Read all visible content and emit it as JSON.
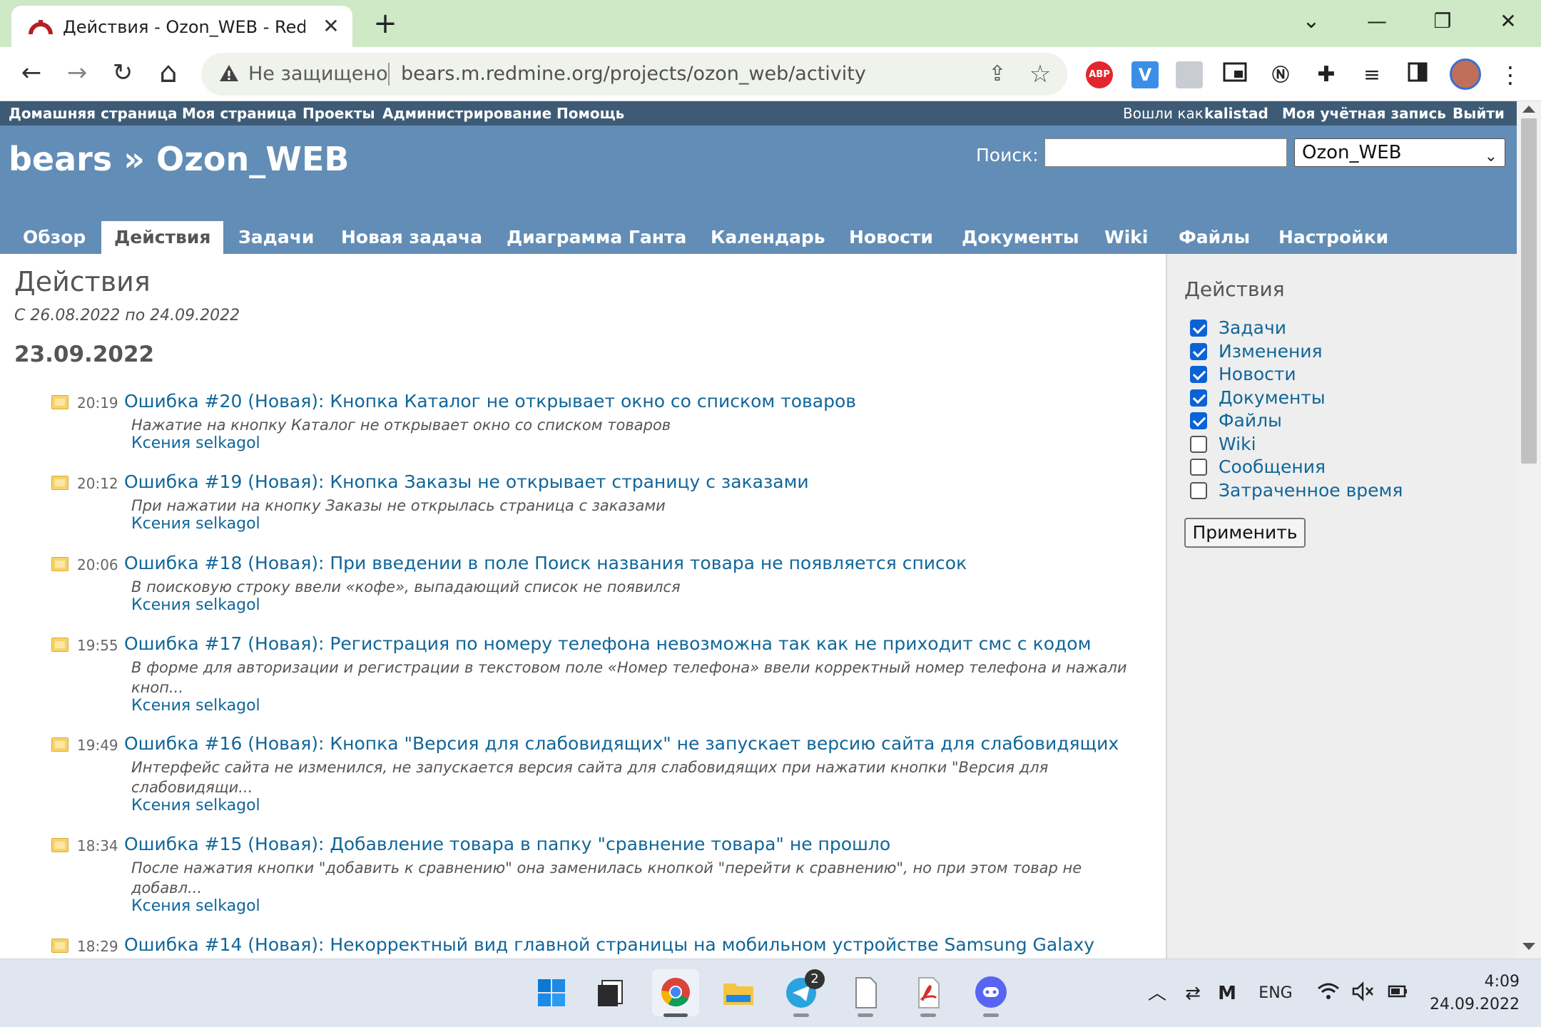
{
  "browser": {
    "tab_title": "Действия - Ozon_WEB - Redmine",
    "tab_close": "✕",
    "new_tab": "+",
    "window_controls": {
      "minimize": "—",
      "restore": "❐",
      "close": "✕",
      "tabs_list": "⌄"
    },
    "nav": {
      "back": "←",
      "forward": "→",
      "reload": "↻",
      "home": "⌂"
    },
    "security_label": "Не защищено",
    "url": "bears.m.redmine.org/projects/ozon_web/activity",
    "extensions": [
      "ABP",
      "V",
      "profile-ext",
      "pip",
      "notion",
      "puzzle",
      "media",
      "sidepanel"
    ],
    "menu": "⋮"
  },
  "top_menu": {
    "left": [
      "Домашняя страница",
      "Моя страница",
      "Проекты",
      "Администрирование",
      "Помощь"
    ],
    "logged_as_prefix": "Вошли как",
    "logged_user": "kalistad",
    "my_account": "Моя учётная запись",
    "logout": "Выйти"
  },
  "header": {
    "title": "bears » Ozon_WEB",
    "search_label": "Поиск:",
    "search_value": "",
    "project_select": "Ozon_WEB"
  },
  "main_menu": {
    "tabs": [
      "Обзор",
      "Действия",
      "Задачи",
      "Новая задача",
      "Диаграмма Ганта",
      "Календарь",
      "Новости",
      "Документы",
      "Wiki",
      "Файлы",
      "Настройки"
    ],
    "selected": "Действия"
  },
  "content": {
    "heading": "Действия",
    "date_range": "С 26.08.2022 по 24.09.2022",
    "day": "23.09.2022",
    "entries": [
      {
        "time": "20:19",
        "title": "Ошибка #20 (Новая): Кнопка Каталог не открывает окно со списком товаров",
        "desc": "Нажатие на кнопку Каталог не открывает окно со списком товаров",
        "author": "Ксения selkagol"
      },
      {
        "time": "20:12",
        "title": "Ошибка #19 (Новая): Кнопка Заказы не открывает страницу с заказами",
        "desc": "При нажатии на кнопку Заказы не открылась страница с заказами",
        "author": "Ксения selkagol"
      },
      {
        "time": "20:06",
        "title": "Ошибка #18 (Новая): При введении в поле Поиск названия товара не появляется список",
        "desc": "В поисковую строку ввели «кофе», выпадающий список не появился",
        "author": "Ксения selkagol"
      },
      {
        "time": "19:55",
        "title": "Ошибка #17 (Новая): Регистрация по номеру телефона невозможна так как не приходит смс с кодом",
        "desc": "В форме для авторизации и регистрации в текстовом поле «Номер телефона» ввели корректный номер телефона и нажали кноп...",
        "author": "Ксения selkagol"
      },
      {
        "time": "19:49",
        "title": "Ошибка #16 (Новая): Кнопка \"Версия для слабовидящих\" не запускает версию сайта для слабовидящих",
        "desc": "Интерфейс сайта не изменился, не запускается версия сайта для слабовидящих при нажатии кнопки \"Версия для слабовидящи...",
        "author": "Ксения selkagol"
      },
      {
        "time": "18:34",
        "title": "Ошибка #15 (Новая): Добавление товара в папку \"сравнение товара\" не прошло",
        "desc": "После нажатия кнопки \"добавить к сравнению\" она заменилась кнопкой \"перейти к сравнению\", но при этом товар не добавл...",
        "author": "Ксения selkagol"
      },
      {
        "time": "18:29",
        "title": "Ошибка #14 (Новая): Некорректный вид главной страницы на мобильном устройстве Samsung Galaxy",
        "desc": "",
        "author": ""
      }
    ]
  },
  "sidebar": {
    "heading": "Действия",
    "filters": [
      {
        "label": "Задачи",
        "checked": true
      },
      {
        "label": "Изменения",
        "checked": true
      },
      {
        "label": "Новости",
        "checked": true
      },
      {
        "label": "Документы",
        "checked": true
      },
      {
        "label": "Файлы",
        "checked": true
      },
      {
        "label": "Wiki",
        "checked": false
      },
      {
        "label": "Сообщения",
        "checked": false
      },
      {
        "label": "Затраченное время",
        "checked": false
      }
    ],
    "apply_label": "Применить"
  },
  "taskbar": {
    "apps": [
      "start",
      "task-view",
      "chrome",
      "file-explorer",
      "telegram",
      "notepad",
      "acrobat",
      "discord"
    ],
    "telegram_badge": "2",
    "tray": {
      "chevron": "︿",
      "language": "ENG"
    },
    "time": "4:09",
    "date": "24.09.2022"
  },
  "colors": {
    "top_menu_bg": "#3e5b76",
    "header_bg": "#628db6",
    "link": "#116699",
    "sidebar_bg": "#eeeeee",
    "chrome_frame": "#cfe8c5"
  }
}
